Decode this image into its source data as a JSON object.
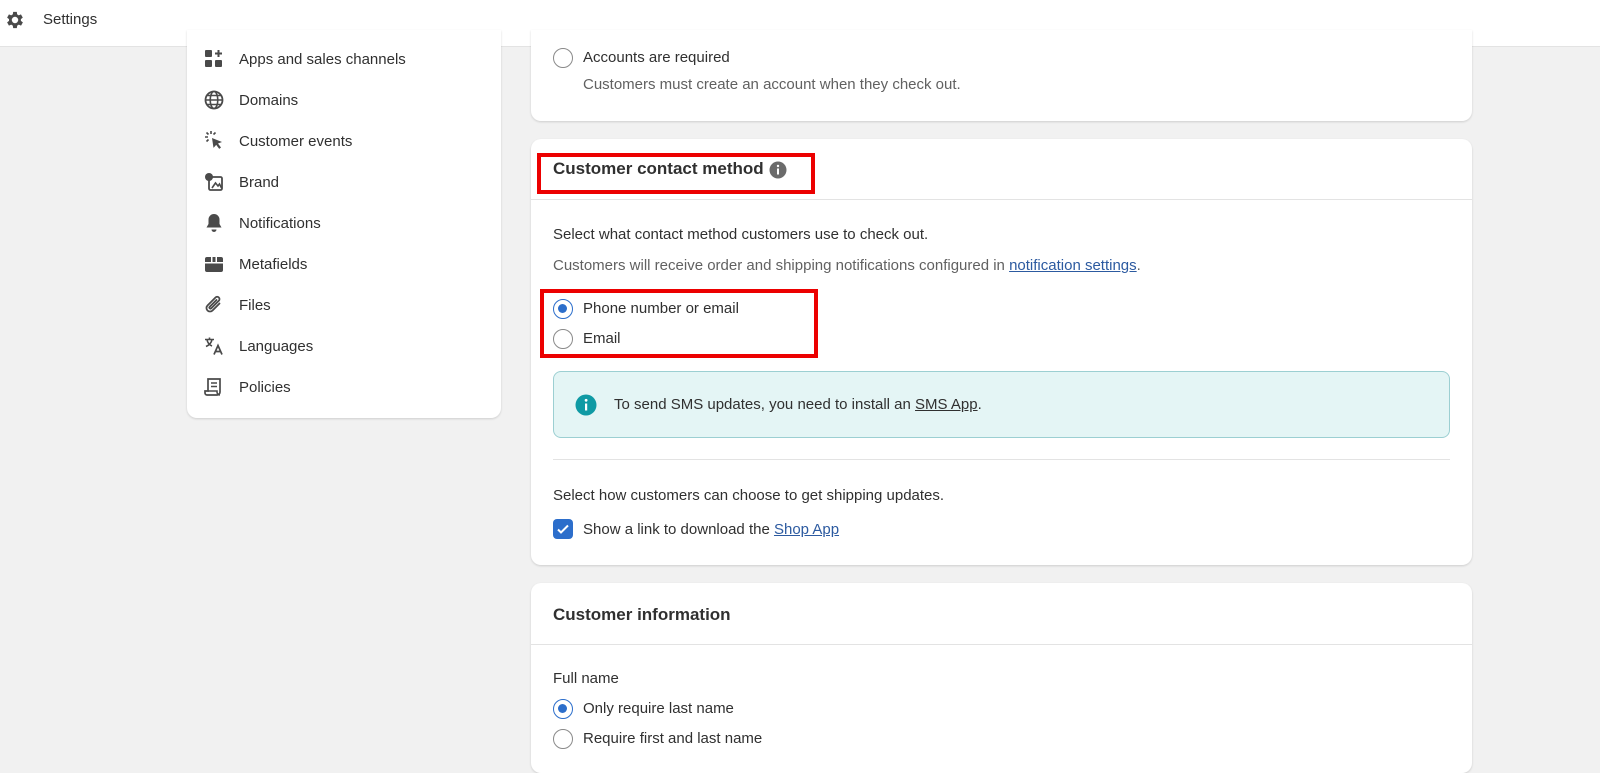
{
  "topbar": {
    "title": "Settings",
    "icon": "gear-icon"
  },
  "sidebar": {
    "items": [
      {
        "label": "Apps and sales channels",
        "icon": "apps-icon"
      },
      {
        "label": "Domains",
        "icon": "globe-icon"
      },
      {
        "label": "Customer events",
        "icon": "cursor-click-icon"
      },
      {
        "label": "Brand",
        "icon": "brand-icon"
      },
      {
        "label": "Notifications",
        "icon": "bell-icon"
      },
      {
        "label": "Metafields",
        "icon": "metafields-icon"
      },
      {
        "label": "Files",
        "icon": "paperclip-icon"
      },
      {
        "label": "Languages",
        "icon": "translate-icon"
      },
      {
        "label": "Policies",
        "icon": "policy-icon"
      }
    ]
  },
  "accounts_card": {
    "option_label": "Accounts are required",
    "option_help": "Customers must create an account when they check out."
  },
  "contact_card": {
    "title": "Customer contact method",
    "description": "Select what contact method customers use to check out.",
    "notice_prefix": "Customers will receive order and shipping notifications configured in ",
    "notice_link": "notification settings",
    "notice_suffix": ".",
    "options": [
      {
        "label": "Phone number or email",
        "checked": true
      },
      {
        "label": "Email",
        "checked": false
      }
    ],
    "banner": {
      "prefix": "To send SMS updates, you need to install an ",
      "link": "SMS App",
      "suffix": "."
    },
    "shipping_prompt": "Select how customers can choose to get shipping updates.",
    "shop_checkbox": {
      "prefix": "Show a link to download the ",
      "link": "Shop App",
      "checked": true
    }
  },
  "info_card": {
    "title": "Customer information",
    "field_label": "Full name",
    "options": [
      {
        "label": "Only require last name",
        "checked": true
      },
      {
        "label": "Require first and last name",
        "checked": false
      }
    ]
  },
  "colors": {
    "accent": "#2c6ecb",
    "highlight": "#ec0000",
    "banner_bg": "#e4f5f5"
  }
}
